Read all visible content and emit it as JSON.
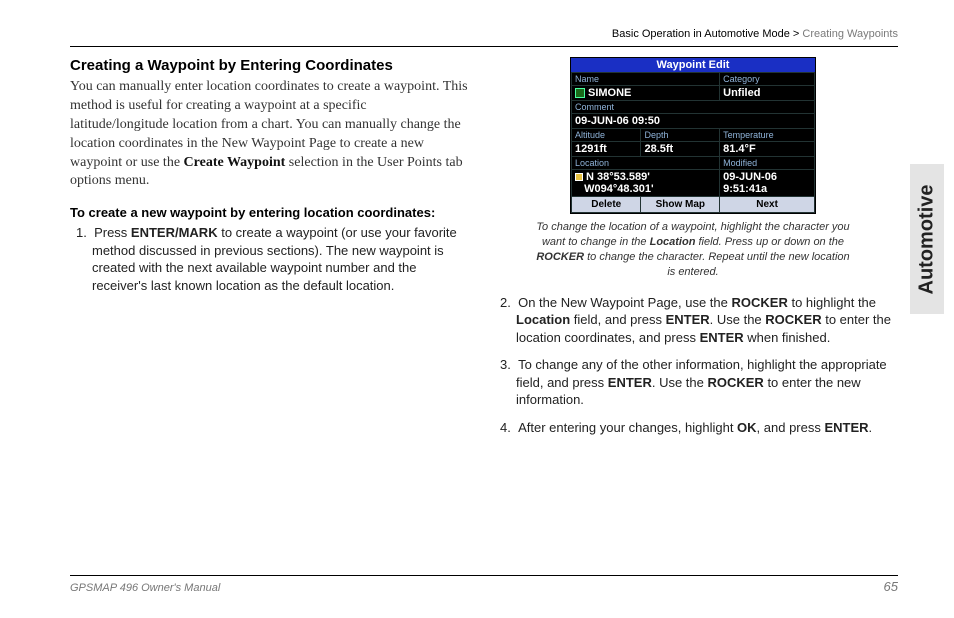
{
  "breadcrumb": {
    "section": "Basic Operation in Automotive Mode",
    "sep": " > ",
    "page": "Creating Waypoints"
  },
  "side_tab": "Automotive",
  "heading": "Creating a Waypoint by Entering Coordinates",
  "intro_pre": "You can manually enter location coordinates to create a waypoint. This method is useful for creating a waypoint at a specific latitude/longitude location from a chart. You can manually change the location coordinates in the New Waypoint Page to create a new waypoint or use the ",
  "intro_bold": "Create Waypoint",
  "intro_post": " selection in the User Points tab options menu.",
  "lead": "To create a new waypoint by entering location coordinates:",
  "step1_num": "1.",
  "step1_a": "Press ",
  "step1_b1": "ENTER/MARK",
  "step1_b": " to create a waypoint (or use your favorite method discussed in previous sections). The new waypoint is created with the next available waypoint number and the receiver's last known location as the default location.",
  "device": {
    "title": "Waypoint Edit",
    "labels": {
      "name": "Name",
      "category": "Category",
      "comment": "Comment",
      "altitude": "Altitude",
      "depth": "Depth",
      "temperature": "Temperature",
      "location": "Location",
      "modified": "Modified"
    },
    "values": {
      "name": "SIMONE",
      "category": "Unfiled",
      "comment": "09-JUN-06 09:50",
      "altitude": "1291ft",
      "depth": "28.5ft",
      "temperature": "81.4°F",
      "loc1": "N 38°53.589'",
      "loc2": "W094°48.301'",
      "mod_date": "09-JUN-06",
      "mod_time": "9:51:41a"
    },
    "buttons": {
      "delete": "Delete",
      "showmap": "Show Map",
      "next": "Next"
    }
  },
  "caption_a": "To change the location of a waypoint, highlight the character you want to change in the ",
  "caption_b1": "Location",
  "caption_b": " field. Press up or down on the ",
  "caption_b2": "ROCKER",
  "caption_c": " to change the character. Repeat until the new location is entered.",
  "step2_num": "2.",
  "step2_a": "On the New Waypoint Page, use the ",
  "step2_b1": "ROCKER",
  "step2_b": " to highlight the ",
  "step2_b2": "Location",
  "step2_c": " field, and press ",
  "step2_b3": "ENTER",
  "step2_d": ". Use the ",
  "step2_b4": "ROCKER",
  "step2_e": " to enter the location coordinates, and press ",
  "step2_b5": "ENTER",
  "step2_f": " when finished.",
  "step3_num": "3.",
  "step3_a": "To change any of the other information, highlight the appropriate field, and press ",
  "step3_b1": "ENTER",
  "step3_b": ". Use the ",
  "step3_b2": "ROCKER",
  "step3_c": " to enter the new information.",
  "step4_num": "4.",
  "step4_a": "After entering your changes, highlight ",
  "step4_b1": "OK",
  "step4_b": ", and press ",
  "step4_b2": "ENTER",
  "step4_c": ".",
  "footer": {
    "left": "GPSMAP 496 Owner's Manual",
    "right": "65"
  }
}
